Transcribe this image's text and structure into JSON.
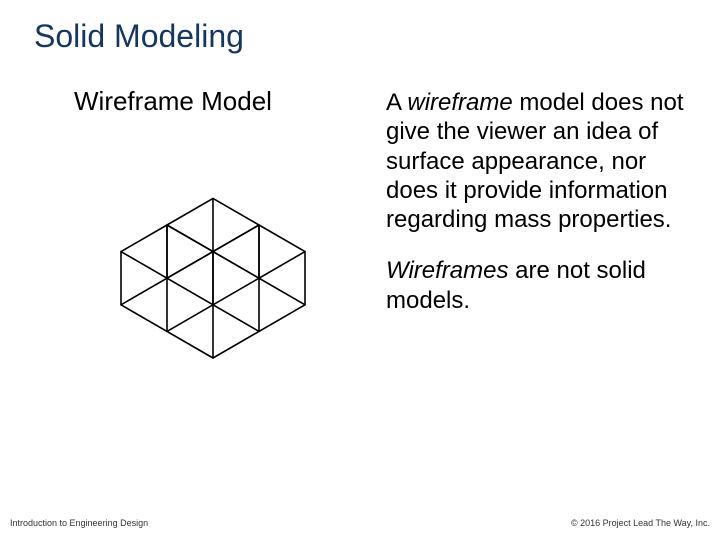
{
  "title": "Solid Modeling",
  "subtitle": "Wireframe Model",
  "paragraph1": {
    "prefix": "A ",
    "emph": "wireframe",
    "rest": " model does not give the viewer an idea of surface appearance, nor does it provide information regarding mass properties."
  },
  "paragraph2": {
    "emph": "Wireframes",
    "rest": " are not solid models."
  },
  "footer": {
    "left": "Introduction to Engineering Design",
    "right": "© 2016 Project Lead The Way, Inc."
  }
}
